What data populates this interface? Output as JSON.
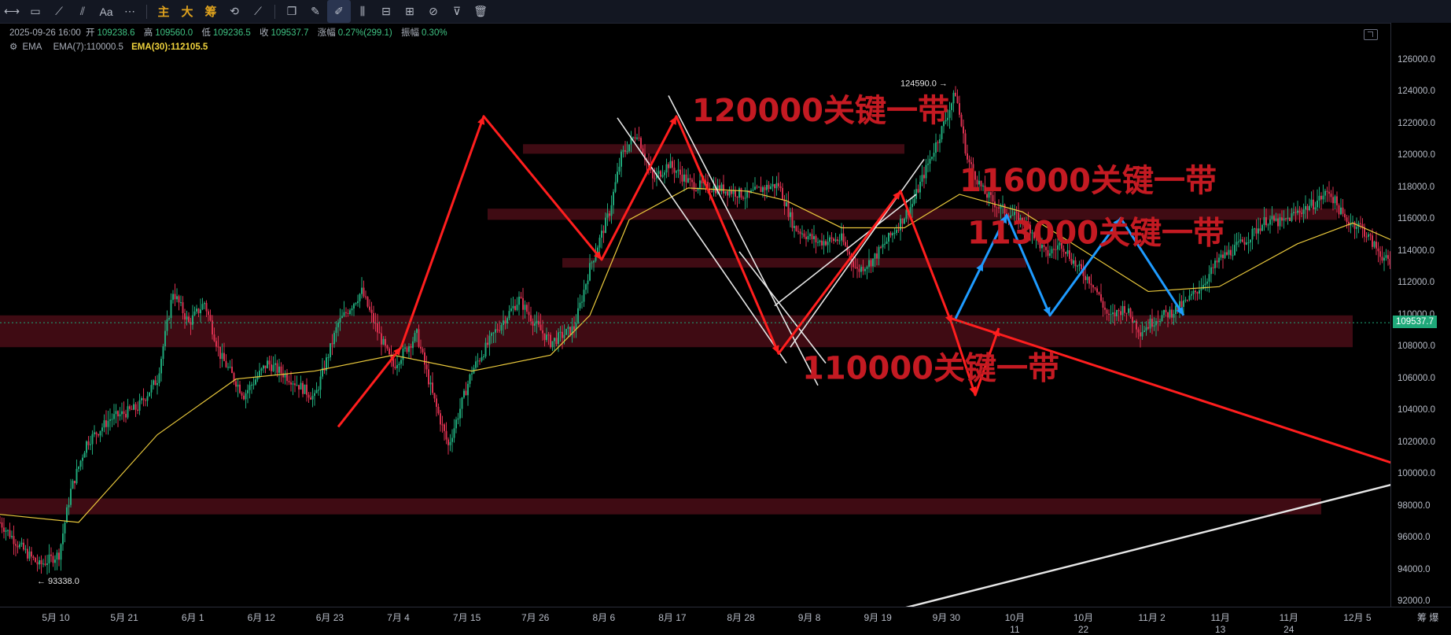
{
  "toolbar": {
    "items": [
      {
        "name": "horizontal-line-tool-icon",
        "glyph": "⟷"
      },
      {
        "name": "rectangle-tool-icon",
        "glyph": "▭"
      },
      {
        "name": "trend-line-tool-icon",
        "glyph": "⟋"
      },
      {
        "name": "parallel-channel-tool-icon",
        "glyph": "⫽"
      },
      {
        "name": "text-tool-icon",
        "glyph": "Aa"
      },
      {
        "name": "more-tools-icon",
        "glyph": "⋯"
      }
    ],
    "cn_buttons": [
      "主",
      "大",
      "筹"
    ],
    "tail_items": [
      {
        "name": "measure-tool-icon",
        "glyph": "⟲"
      },
      {
        "name": "magnet-tool-icon",
        "glyph": "⟋"
      },
      {
        "name": "copy-tool-icon",
        "glyph": "❐"
      },
      {
        "name": "pencil-tool-icon",
        "glyph": "✎"
      },
      {
        "name": "brush-tool-icon",
        "glyph": "✐"
      },
      {
        "name": "bars-tool-icon",
        "glyph": "⫼"
      },
      {
        "name": "lock-tool-icon",
        "glyph": "⊟"
      },
      {
        "name": "template-tool-icon",
        "glyph": "⊞"
      },
      {
        "name": "hide-tool-icon",
        "glyph": "⊘"
      },
      {
        "name": "filter-tool-icon",
        "glyph": "⊽"
      },
      {
        "name": "delete-tool-icon",
        "glyph": "🗑"
      }
    ]
  },
  "info": {
    "datetime": "2025-09-26 16:00",
    "open_label": "开",
    "open": "109238.6",
    "high_label": "高",
    "high": "109560.0",
    "low_label": "低",
    "low": "109236.5",
    "close_label": "收",
    "close": "109537.7",
    "change_label": "涨幅",
    "change": "0.27%(299.1)",
    "amp_label": "振幅",
    "amp": "0.30%",
    "ema_label": "EMA",
    "ema7": "EMA(7):110000.5",
    "ema30": "EMA(30):112105.5"
  },
  "chart_data": {
    "type": "candlestick",
    "ylim": [
      91000,
      127000
    ],
    "y_ticks": [
      "126000.0",
      "124000.0",
      "122000.0",
      "120000.0",
      "118000.0",
      "116000.0",
      "114000.0",
      "112000.0",
      "110000.0",
      "108000.0",
      "106000.0",
      "104000.0",
      "102000.0",
      "100000.0",
      "98000.0",
      "96000.0",
      "94000.0",
      "92000.0"
    ],
    "x_ticks": [
      "5月 10",
      "5月 21",
      "6月 1",
      "6月 12",
      "6月 23",
      "7月 4",
      "7月 15",
      "7月 26",
      "8月 6",
      "8月 17",
      "8月 28",
      "9月 8",
      "9月 19",
      "9月 30",
      "10月 11",
      "10月 22",
      "11月 2",
      "11月 13",
      "11月 24",
      "12月 5"
    ],
    "axis_corner_label": "筹 爆",
    "last_price": "109537.7",
    "high_marker": "124590.0 →",
    "low_marker": "← 93338.0",
    "price_path": [
      [
        0,
        97000
      ],
      [
        5,
        95500
      ],
      [
        10,
        94300
      ],
      [
        15,
        95000
      ],
      [
        18,
        99000
      ],
      [
        22,
        102000
      ],
      [
        28,
        103500
      ],
      [
        35,
        104200
      ],
      [
        40,
        106000
      ],
      [
        44,
        111500
      ],
      [
        48,
        109500
      ],
      [
        52,
        110800
      ],
      [
        56,
        107500
      ],
      [
        62,
        105000
      ],
      [
        68,
        107000
      ],
      [
        74,
        106000
      ],
      [
        80,
        104800
      ],
      [
        86,
        109500
      ],
      [
        92,
        111500
      ],
      [
        96,
        109000
      ],
      [
        100,
        106800
      ],
      [
        106,
        108800
      ],
      [
        110,
        105000
      ],
      [
        114,
        101800
      ],
      [
        120,
        106500
      ],
      [
        126,
        109000
      ],
      [
        132,
        111000
      ],
      [
        136,
        109500
      ],
      [
        140,
        108300
      ],
      [
        146,
        109200
      ],
      [
        150,
        113000
      ],
      [
        155,
        116500
      ],
      [
        158,
        120000
      ],
      [
        162,
        121500
      ],
      [
        166,
        118500
      ],
      [
        170,
        119500
      ],
      [
        176,
        118200
      ],
      [
        182,
        118000
      ],
      [
        186,
        117800
      ],
      [
        190,
        117500
      ],
      [
        194,
        118000
      ],
      [
        198,
        118200
      ],
      [
        202,
        115500
      ],
      [
        208,
        114600
      ],
      [
        214,
        114800
      ],
      [
        218,
        112800
      ],
      [
        222,
        113500
      ],
      [
        228,
        115500
      ],
      [
        232,
        117000
      ],
      [
        236,
        119500
      ],
      [
        240,
        122000
      ],
      [
        243,
        124000
      ],
      [
        246,
        119800
      ],
      [
        250,
        117800
      ],
      [
        254,
        116800
      ],
      [
        258,
        116200
      ],
      [
        262,
        115500
      ],
      [
        266,
        113800
      ],
      [
        270,
        114500
      ],
      [
        274,
        113000
      ],
      [
        278,
        112000
      ],
      [
        282,
        109800
      ],
      [
        286,
        110500
      ],
      [
        290,
        109000
      ],
      [
        294,
        109800
      ],
      [
        298,
        110200
      ],
      [
        302,
        110900
      ],
      [
        306,
        112000
      ],
      [
        310,
        113500
      ],
      [
        314,
        114200
      ],
      [
        318,
        115000
      ],
      [
        322,
        116000
      ],
      [
        326,
        115800
      ],
      [
        330,
        116500
      ],
      [
        334,
        117000
      ],
      [
        338,
        117800
      ],
      [
        342,
        116000
      ],
      [
        346,
        115600
      ],
      [
        350,
        114200
      ],
      [
        354,
        113000
      ],
      [
        358,
        111200
      ],
      [
        362,
        109537.7
      ]
    ],
    "ema30_path": [
      [
        0,
        97500
      ],
      [
        20,
        97000
      ],
      [
        40,
        102500
      ],
      [
        60,
        106000
      ],
      [
        80,
        106500
      ],
      [
        100,
        107500
      ],
      [
        120,
        106500
      ],
      [
        140,
        107500
      ],
      [
        150,
        110000
      ],
      [
        160,
        116000
      ],
      [
        175,
        118000
      ],
      [
        190,
        117800
      ],
      [
        200,
        117200
      ],
      [
        214,
        115500
      ],
      [
        230,
        115500
      ],
      [
        244,
        117600
      ],
      [
        260,
        116500
      ],
      [
        276,
        114000
      ],
      [
        292,
        111500
      ],
      [
        310,
        111800
      ],
      [
        330,
        114500
      ],
      [
        344,
        115800
      ],
      [
        356,
        114500
      ],
      [
        362,
        112105.5
      ]
    ],
    "zones": [
      {
        "from_day": 133,
        "to_day": 230,
        "low": 120150,
        "high": 120750
      },
      {
        "from_day": 124,
        "to_day": 340,
        "low": 116000,
        "high": 116700
      },
      {
        "from_day": 143,
        "to_day": 261,
        "low": 113000,
        "high": 113600
      },
      {
        "from_day": 0,
        "to_day": 344,
        "low": 108000,
        "high": 110000
      },
      {
        "from_day": 0,
        "to_day": 336,
        "low": 97500,
        "high": 98500
      }
    ],
    "annotations": [
      {
        "text": "120000关键一带",
        "day": 176,
        "price": 122200
      },
      {
        "text": "116000关键一带",
        "day": 244,
        "price": 117800
      },
      {
        "text": "113000关键一带",
        "day": 246,
        "price": 114500
      },
      {
        "text": "110000关键一带",
        "day": 204,
        "price": 106000
      }
    ],
    "red_paths": [
      [
        [
          102,
          108000
        ],
        [
          123,
          122500
        ],
        [
          153,
          113500
        ],
        [
          172,
          122500
        ],
        [
          198,
          107600
        ],
        [
          229,
          117800
        ],
        [
          242,
          109500
        ],
        [
          248,
          105000
        ],
        [
          254,
          109200
        ]
      ],
      [
        [
          86,
          103000
        ],
        [
          102,
          108000
        ]
      ],
      [
        [
          242,
          109800
        ],
        [
          363,
          100000
        ]
      ]
    ],
    "blue_paths": [
      [
        [
          243,
          109800
        ],
        [
          250,
          113300
        ],
        [
          256,
          116300
        ],
        [
          267,
          110000
        ],
        [
          285,
          116100
        ],
        [
          301,
          110000
        ]
      ]
    ],
    "white_channel": [
      [
        [
          157,
          122400
        ],
        [
          200,
          107000
        ]
      ],
      [
        [
          170,
          123800
        ],
        [
          208,
          105600
        ]
      ],
      [
        [
          201,
          108000
        ],
        [
          235,
          119800
        ]
      ],
      [
        [
          197,
          110600
        ],
        [
          233,
          117600
        ]
      ],
      [
        [
          188,
          114000
        ],
        [
          210,
          107000
        ]
      ],
      [
        [
          228,
          91500
        ],
        [
          364,
          100000
        ]
      ]
    ]
  }
}
